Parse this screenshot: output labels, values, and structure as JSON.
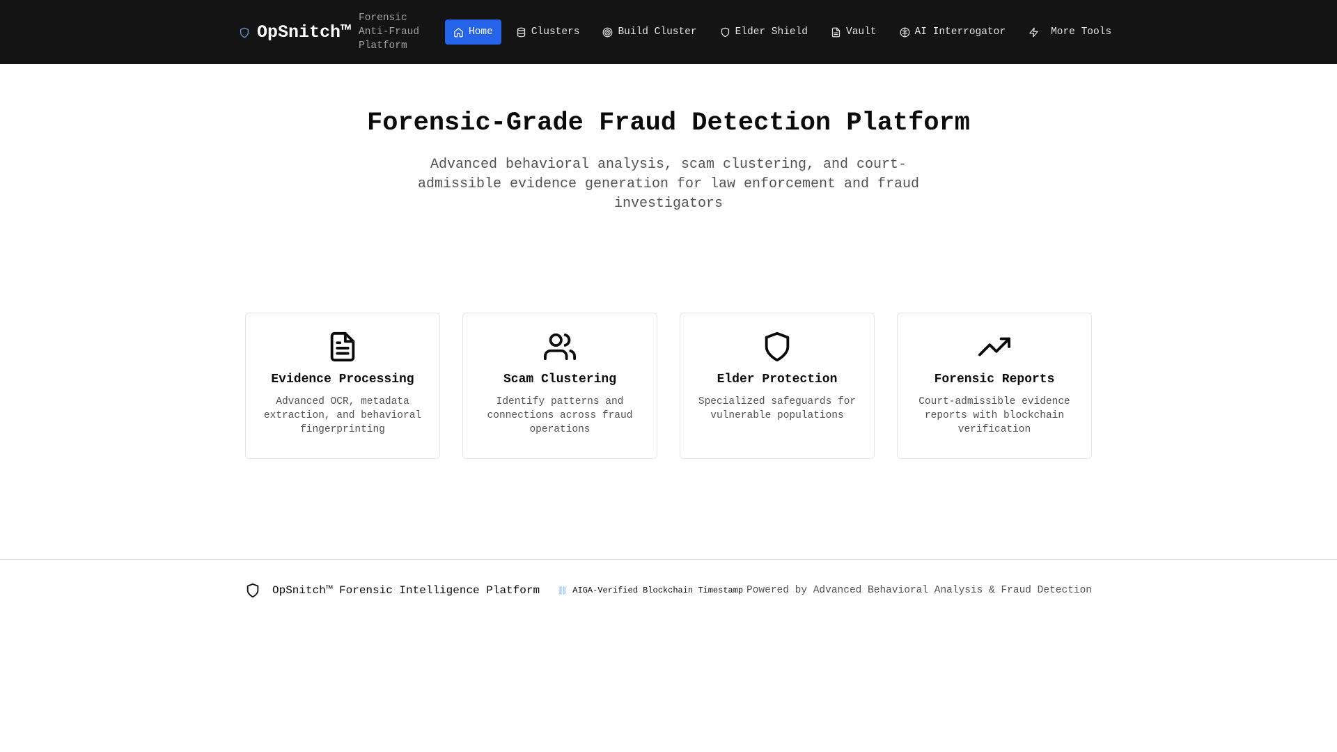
{
  "brand": {
    "name": "OpSnitch™",
    "subtitle": "Forensic Anti-Fraud Platform",
    "accent": "#2563eb"
  },
  "nav": {
    "items": [
      {
        "label": "Home",
        "icon": "home-icon",
        "active": true
      },
      {
        "label": "Clusters",
        "icon": "database-icon"
      },
      {
        "label": "Build Cluster",
        "icon": "target-icon"
      },
      {
        "label": "Elder Shield",
        "icon": "shield-icon"
      },
      {
        "label": "Vault",
        "icon": "file-icon"
      },
      {
        "label": "AI Interrogator",
        "icon": "brain-icon"
      },
      {
        "label": "More Tools",
        "icon": "zap-icon"
      }
    ]
  },
  "hero": {
    "title": "Forensic-Grade Fraud Detection Platform",
    "subtitle": "Advanced behavioral analysis, scam clustering, and court-admissible evidence generation for law enforcement and fraud investigators"
  },
  "features": [
    {
      "title": "Evidence Processing",
      "description": "Advanced OCR, metadata extraction, and behavioral fingerprinting",
      "icon": "file-text-icon"
    },
    {
      "title": "Scam Clustering",
      "description": "Identify patterns and connections across fraud operations",
      "icon": "users-icon"
    },
    {
      "title": "Elder Protection",
      "description": "Specialized safeguards for vulnerable populations",
      "icon": "shield-icon"
    },
    {
      "title": "Forensic Reports",
      "description": "Court-admissible evidence reports with blockchain verification",
      "icon": "trending-up-icon"
    }
  ],
  "footer": {
    "name": "OpSnitch™ Forensic Intelligence Platform",
    "chain_icon": "⛓",
    "chain_label": "AIGA-Verified Blockchain Timestamp",
    "powered": "Powered by Advanced Behavioral Analysis & Fraud Detection"
  }
}
